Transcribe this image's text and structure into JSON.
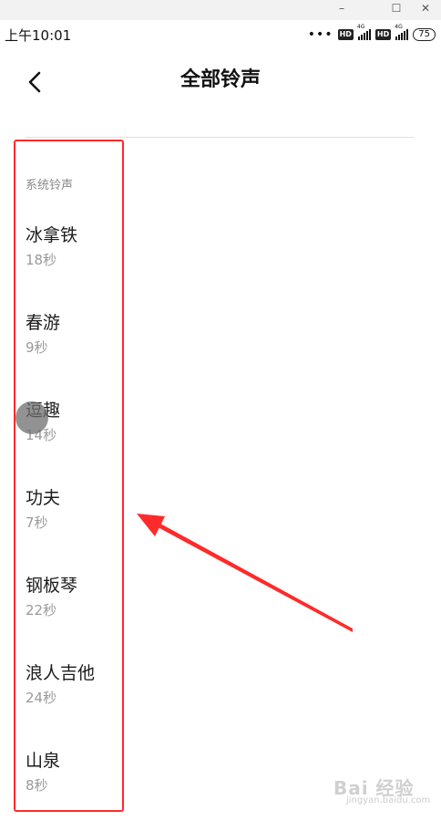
{
  "header": {
    "title": "全部铃声"
  },
  "status_bar": {
    "time": "上午10:01",
    "network": "4G",
    "hd": "HD",
    "battery": "75"
  },
  "list": {
    "section_label": "系统铃声",
    "items": [
      {
        "name": "冰拿铁",
        "duration": "18秒"
      },
      {
        "name": "春游",
        "duration": "9秒"
      },
      {
        "name": "逗趣",
        "duration": "14秒"
      },
      {
        "name": "功夫",
        "duration": "7秒"
      },
      {
        "name": "钢板琴",
        "duration": "22秒"
      },
      {
        "name": "浪人吉他",
        "duration": "24秒"
      },
      {
        "name": "山泉",
        "duration": "8秒"
      }
    ]
  },
  "annotation": {
    "highlight_color": "#ff2a2a"
  },
  "watermark": {
    "text": "Bai 经验",
    "sub": "jingyan.baidu.com"
  },
  "window_controls": {
    "minimize": "–",
    "maximize": "☐",
    "close": "✕"
  }
}
